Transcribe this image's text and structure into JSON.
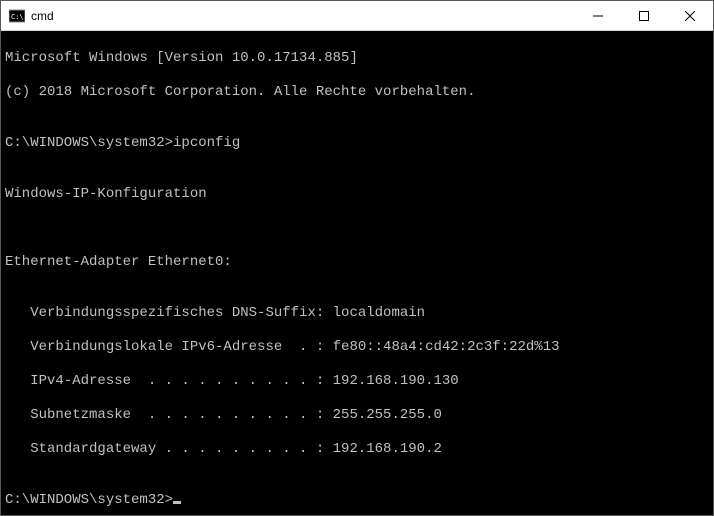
{
  "titlebar": {
    "title": "cmd"
  },
  "terminal": {
    "line0": "Microsoft Windows [Version 10.0.17134.885]",
    "line1": "(c) 2018 Microsoft Corporation. Alle Rechte vorbehalten.",
    "line2": "",
    "line3": "C:\\WINDOWS\\system32>ipconfig",
    "line4": "",
    "line5": "Windows-IP-Konfiguration",
    "line6": "",
    "line7": "",
    "line8": "Ethernet-Adapter Ethernet0:",
    "line9": "",
    "line10": "   Verbindungsspezifisches DNS-Suffix: localdomain",
    "line11": "   Verbindungslokale IPv6-Adresse  . : fe80::48a4:cd42:2c3f:22d%13",
    "line12": "   IPv4-Adresse  . . . . . . . . . . : 192.168.190.130",
    "line13": "   Subnetzmaske  . . . . . . . . . . : 255.255.255.0",
    "line14": "   Standardgateway . . . . . . . . . : 192.168.190.2",
    "line15": "",
    "prompt": "C:\\WINDOWS\\system32>"
  }
}
